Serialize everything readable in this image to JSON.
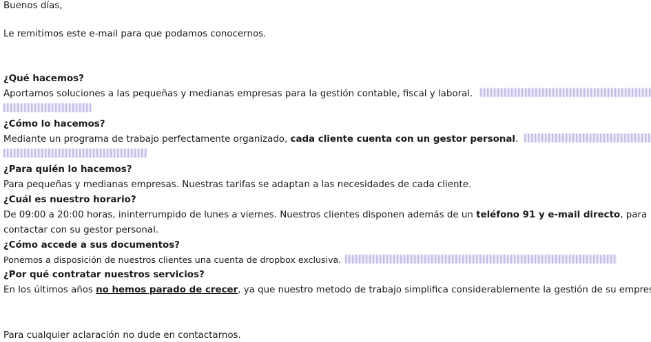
{
  "greeting": "Buenos días,",
  "intro": "Le remitimos este e-mail para que podamos conocernos.",
  "sections": [
    {
      "heading": "¿Qué hacemos?",
      "text": "Aportamos soluciones a las pequeñas y medianas empresas para la gestión contable, fiscal y laboral."
    },
    {
      "heading": "¿Cómo lo hacemos?",
      "text_before": "Mediante un programa de trabajo perfectamente organizado,",
      "text_bold": "cada cliente cuenta con un gestor personal",
      "text_after": "."
    },
    {
      "heading": "¿Para quién lo hacemos?",
      "text": "Para pequeñas y medianas empresas. Nuestras tarifas se adaptan a las necesidades de cada cliente."
    },
    {
      "heading": "¿Cuál es nuestro horario?",
      "text_before": "De 09:00 a 20:00 horas, ininterrumpido de lunes a viernes. Nuestros clientes disponen además de un",
      "text_bold": "teléfono 91 y e-mail directo",
      "text_after": ", para",
      "text_line2": "contactar con su gestor personal."
    },
    {
      "heading": "¿Cómo accede a sus documentos?",
      "text": "Ponemos a disposición de nuestros clientes una cuenta de dropbox exclusiva."
    },
    {
      "heading": "¿Por qué contratar nuestros servicios?",
      "text_before": "En los últimos años",
      "text_underlined": "no hemos parado de crecer",
      "text_after": ", ya que nuestro metodo de trabajo simplifica considerablemente la gestión de su empresa."
    }
  ],
  "closing": "Para cualquier aclaración no dude en contactarnos."
}
